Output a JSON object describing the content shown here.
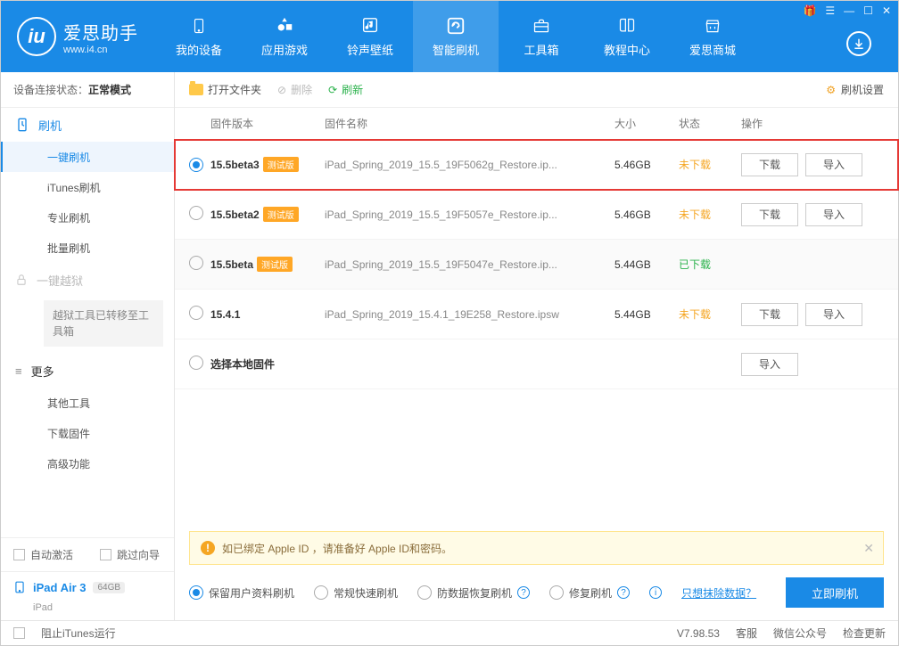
{
  "logo": {
    "letters": "iu",
    "title": "爱思助手",
    "sub": "www.i4.cn"
  },
  "titlebar_icons": [
    "🎁",
    "☰",
    "—",
    "☐",
    "✕"
  ],
  "nav": [
    {
      "label": "我的设备",
      "icon": "phone"
    },
    {
      "label": "应用游戏",
      "icon": "apps"
    },
    {
      "label": "铃声壁纸",
      "icon": "music"
    },
    {
      "label": "智能刷机",
      "icon": "flash",
      "active": true
    },
    {
      "label": "工具箱",
      "icon": "toolbox"
    },
    {
      "label": "教程中心",
      "icon": "book"
    },
    {
      "label": "爱思商城",
      "icon": "shop"
    }
  ],
  "conn": {
    "label": "设备连接状态：",
    "value": "正常模式"
  },
  "sidebar": {
    "flash": {
      "label": "刷机",
      "items": [
        "一键刷机",
        "iTunes刷机",
        "专业刷机",
        "批量刷机"
      ],
      "active": 0
    },
    "jailbreak": {
      "label": "一键越狱",
      "note": "越狱工具已转移至工具箱"
    },
    "more": {
      "label": "更多",
      "items": [
        "其他工具",
        "下载固件",
        "高级功能"
      ]
    }
  },
  "side_bottom": {
    "auto_activate": "自动激活",
    "skip_guide": "跳过向导"
  },
  "device": {
    "name": "iPad Air 3",
    "storage": "64GB",
    "type": "iPad"
  },
  "toolbar": {
    "open": "打开文件夹",
    "del": "删除",
    "refresh": "刷新",
    "settings": "刷机设置"
  },
  "columns": {
    "ver": "固件版本",
    "name": "固件名称",
    "size": "大小",
    "stat": "状态",
    "ops": "操作"
  },
  "btn": {
    "download": "下载",
    "import": "导入"
  },
  "beta_tag": "测试版",
  "rows": [
    {
      "selected": true,
      "ver": "15.5beta3",
      "beta": true,
      "name": "iPad_Spring_2019_15.5_19F5062g_Restore.ip...",
      "size": "5.46GB",
      "stat": "未下载",
      "stat_cls": "stat-orange",
      "ops": [
        "download",
        "import"
      ],
      "hl": true
    },
    {
      "selected": false,
      "ver": "15.5beta2",
      "beta": true,
      "name": "iPad_Spring_2019_15.5_19F5057e_Restore.ip...",
      "size": "5.46GB",
      "stat": "未下载",
      "stat_cls": "stat-orange",
      "ops": [
        "download",
        "import"
      ]
    },
    {
      "selected": false,
      "ver": "15.5beta",
      "beta": true,
      "name": "iPad_Spring_2019_15.5_19F5047e_Restore.ip...",
      "size": "5.44GB",
      "stat": "已下载",
      "stat_cls": "stat-green",
      "ops": [],
      "alt": true
    },
    {
      "selected": false,
      "ver": "15.4.1",
      "beta": false,
      "name": "iPad_Spring_2019_15.4.1_19E258_Restore.ipsw",
      "size": "5.44GB",
      "stat": "未下载",
      "stat_cls": "stat-orange",
      "ops": [
        "download",
        "import"
      ]
    },
    {
      "selected": false,
      "ver": "选择本地固件",
      "beta": false,
      "name": "",
      "size": "",
      "stat": "",
      "stat_cls": "",
      "ops": [
        "import"
      ]
    }
  ],
  "notice": "如已绑定 Apple ID ，请准备好 Apple ID和密码。",
  "flash_opts": {
    "keep": "保留用户资料刷机",
    "normal": "常规快速刷机",
    "recover": "防数据恢复刷机",
    "repair": "修复刷机",
    "erase_link": "只想抹除数据？",
    "go": "立即刷机"
  },
  "statusbar": {
    "block_itunes": "阻止iTunes运行",
    "ver_label": "V7.98.53",
    "kefu": "客服",
    "wechat": "微信公众号",
    "update": "检查更新"
  }
}
